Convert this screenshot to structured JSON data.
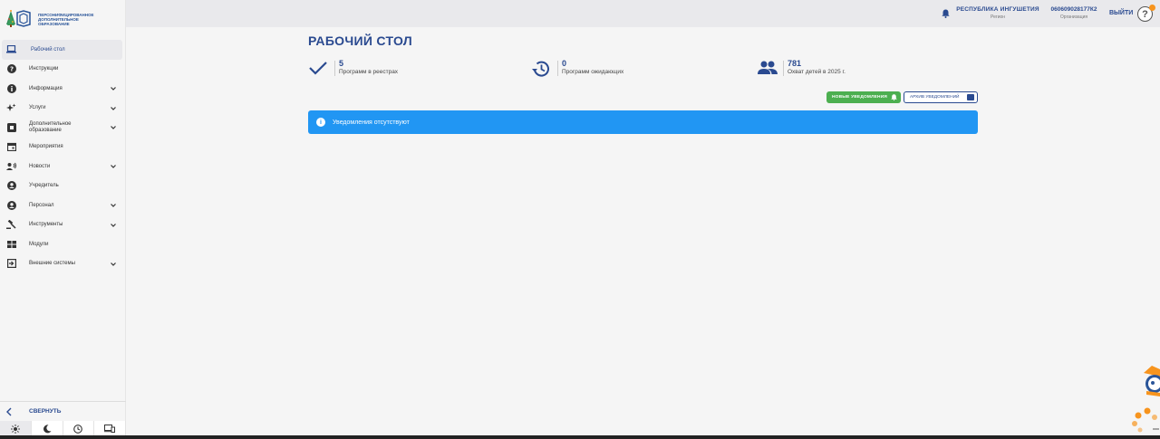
{
  "brand": {
    "logo_text": "Персонифицированное дополнительное образование"
  },
  "sidebar": {
    "items": [
      {
        "label": "Рабочий стол",
        "icon": "laptop-icon",
        "active": true,
        "chevron": false
      },
      {
        "label": "Инструкции",
        "icon": "help-circle-icon",
        "chevron": false
      },
      {
        "label": "Информация",
        "icon": "info-icon",
        "chevron": true
      },
      {
        "label": "Услуги",
        "icon": "sparkle-icon",
        "chevron": true
      },
      {
        "label": "Дополнительное образование",
        "icon": "puzzle-icon",
        "chevron": true
      },
      {
        "label": "Мероприятия",
        "icon": "calendar-icon",
        "chevron": false
      },
      {
        "label": "Новости",
        "icon": "megaphone-person-icon",
        "chevron": true
      },
      {
        "label": "Учредитель",
        "icon": "account-circle-icon",
        "chevron": false
      },
      {
        "label": "Персонал",
        "icon": "account-circle-icon",
        "chevron": true
      },
      {
        "label": "Инструменты",
        "icon": "gavel-icon",
        "chevron": true
      },
      {
        "label": "Модули",
        "icon": "grid-icon",
        "chevron": false
      },
      {
        "label": "Внешние системы",
        "icon": "login-icon",
        "chevron": true
      }
    ],
    "collapse_label": "СВЕРНУТЬ",
    "theme_buttons": [
      "sun-icon",
      "moon-icon",
      "clock-icon",
      "devices-icon"
    ]
  },
  "header": {
    "region_title": "РЕСПУБЛИКА ИНГУШЕТИЯ",
    "region_sub": "Регион",
    "org_title": "060609028177К2",
    "org_sub": "Организация",
    "logout_label": "ВЫЙТИ",
    "help_label": "?"
  },
  "main": {
    "title": "РАБОЧИЙ СТОЛ",
    "stats": [
      {
        "value": "5",
        "caption": "Программ в реестрах",
        "icon": "check-icon"
      },
      {
        "value": "0",
        "caption": "Программ ожидающих",
        "icon": "history-icon"
      },
      {
        "value": "781",
        "caption": "Охват детей в 2025 г.",
        "icon": "people-icon"
      }
    ],
    "new_notifications_label": "НОВЫЕ УВЕДОМЛЕНИЯ",
    "archive_notifications_label": "АРХИВ УВЕДОМЛЕНИЙ",
    "alert_text": "Уведомления отсутствуют"
  },
  "colors": {
    "accent": "#2a4a90",
    "alert": "#2196f3",
    "success": "#4caf50",
    "orange": "#f7941d"
  }
}
